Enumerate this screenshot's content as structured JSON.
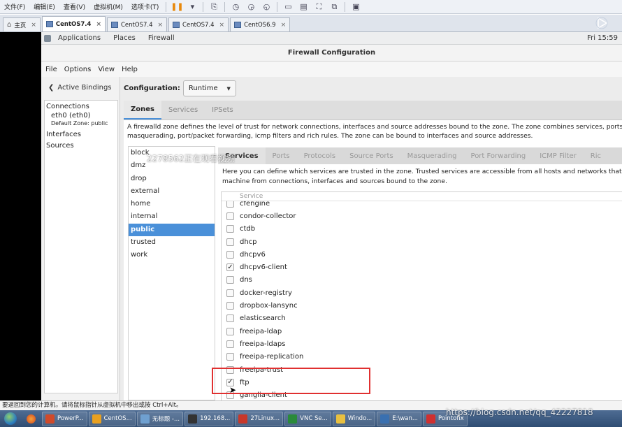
{
  "vmware": {
    "menu": [
      "文件(F)",
      "编辑(E)",
      "查看(V)",
      "虚拟机(M)",
      "选项卡(T)"
    ],
    "tabs": [
      {
        "label": "主页",
        "icon": "home-icon",
        "active": false
      },
      {
        "label": "CentOS7.4",
        "icon": "vm-icon",
        "active": true
      },
      {
        "label": "CentOS7.4",
        "icon": "vm-icon",
        "active": false
      },
      {
        "label": "CentOS7.4",
        "icon": "vm-icon",
        "active": false
      },
      {
        "label": "CentOS6.9",
        "icon": "vm-icon",
        "active": false
      }
    ],
    "status_text": "要返回到您的计算机，请将鼠标指针从虚拟机中移出或按 Ctrl+Alt。"
  },
  "gnome": {
    "applications": "Applications",
    "places": "Places",
    "app_name": "Firewall",
    "clock": "Fri 15:59"
  },
  "window": {
    "title": "Firewall Configuration",
    "menu": [
      "File",
      "Options",
      "View",
      "Help"
    ]
  },
  "bindings": {
    "toggle_label": "Active Bindings",
    "connections_heading": "Connections",
    "connection_name": "eth0 (eth0)",
    "connection_default": "Default Zone: public",
    "interfaces_heading": "Interfaces",
    "sources_heading": "Sources"
  },
  "config": {
    "label": "Configuration:",
    "value": "Runtime"
  },
  "zone_tabs": [
    "Zones",
    "Services",
    "IPSets"
  ],
  "zone_description_line1": "A firewalld zone defines the level of trust for network connections, interfaces and source addresses bound to the zone. The zone combines services, ports, p",
  "zone_description_line2": "masquerading, port/packet forwarding, icmp filters and rich rules. The zone can be bound to interfaces and source addresses.",
  "zones": [
    "block",
    "dmz",
    "drop",
    "external",
    "home",
    "internal",
    "public",
    "trusted",
    "work"
  ],
  "selected_zone": "public",
  "service_tabs": [
    "Services",
    "Ports",
    "Protocols",
    "Source Ports",
    "Masquerading",
    "Port Forwarding",
    "ICMP Filter",
    "Ric"
  ],
  "services_description_line1": "Here you can define which services are trusted in the zone. Trusted services are accessible from all hosts and networks that ca",
  "services_description_line2": "machine from connections, interfaces and sources bound to the zone.",
  "service_column_header": "Service",
  "services": [
    {
      "name": "cfengine",
      "checked": false
    },
    {
      "name": "condor-collector",
      "checked": false
    },
    {
      "name": "ctdb",
      "checked": false
    },
    {
      "name": "dhcp",
      "checked": false
    },
    {
      "name": "dhcpv6",
      "checked": false
    },
    {
      "name": "dhcpv6-client",
      "checked": true
    },
    {
      "name": "dns",
      "checked": false
    },
    {
      "name": "docker-registry",
      "checked": false
    },
    {
      "name": "dropbox-lansync",
      "checked": false
    },
    {
      "name": "elasticsearch",
      "checked": false
    },
    {
      "name": "freeipa-ldap",
      "checked": false
    },
    {
      "name": "freeipa-ldaps",
      "checked": false
    },
    {
      "name": "freeipa-replication",
      "checked": false
    },
    {
      "name": "freeipa-trust",
      "checked": false
    },
    {
      "name": "ftp",
      "checked": true
    },
    {
      "name": "ganglia-client",
      "checked": false
    }
  ],
  "watermark_text": "2278562正在观看视频",
  "taskbar": {
    "items": [
      {
        "label": "PowerP...",
        "color": "#d04a2a"
      },
      {
        "label": "CentOS...",
        "color": "#e8a020"
      },
      {
        "label": "无标题 -...",
        "color": "#6fa0d0"
      },
      {
        "label": "192.168...",
        "color": "#333333"
      },
      {
        "label": "27Linux...",
        "color": "#c8382a"
      },
      {
        "label": "VNC Se...",
        "color": "#2a8a3a"
      },
      {
        "label": "Windo...",
        "color": "#e8c040"
      },
      {
        "label": "E:\\wan...",
        "color": "#3a70b0"
      },
      {
        "label": "Pointofix",
        "color": "#d03030"
      }
    ]
  },
  "csdn_watermark": "https://blog.csdn.net/qq_42227818"
}
